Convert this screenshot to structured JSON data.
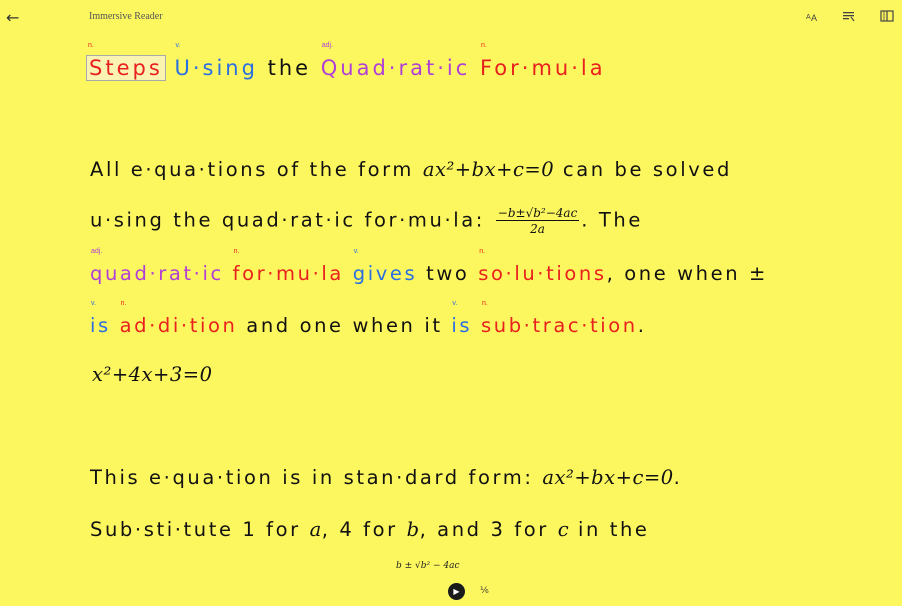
{
  "app": {
    "title": "Immersive Reader",
    "back_icon": "←",
    "icons": [
      "text-size-icon",
      "grammar-options-icon",
      "reading-preferences-icon"
    ]
  },
  "colors": {
    "background": "#fdf75f",
    "noun": "#e8201e",
    "verb": "#2a6fe0",
    "adjective": "#b13fd6"
  },
  "pos_labels": {
    "noun": "n.",
    "verb": "v.",
    "adjective": "adj."
  },
  "title": {
    "w1": "Steps",
    "w2": "U·sing",
    "w3": "the",
    "w4": "Quad·rat·ic",
    "w5": "For·mu·la"
  },
  "p1": {
    "t1": "All e·qua·tions of the form",
    "eq": "ax²+bx+c=0",
    "t2": "can be solved",
    "t3": "u·sing the quad·rat·ic for·mu·la:",
    "frac_num": "−b±√b²−4ac",
    "frac_den": "2a",
    "t4": ". The",
    "w_quad": "quad·rat·ic",
    "w_form": "for·mu·la",
    "w_gives": "gives",
    "t5": "two",
    "w_sol": "so·lu·tions",
    "t6": ", one when ±",
    "w_is1": "is",
    "w_add": "ad·di·tion",
    "t7": "and one when it",
    "w_is2": "is",
    "w_sub": "sub·trac·tion",
    "t8": "."
  },
  "eq2": "x²+4x+3=0",
  "p2": {
    "t1": "This e·qua·tion is in stan·dard form:",
    "eq": "ax²+bx+c=0",
    "t2": "."
  },
  "p3": {
    "t1": "Sub·sti·tute 1 for",
    "a": "a",
    "t2": ", 4 for",
    "b": "b",
    "t3": ", and 3 for",
    "c": "c",
    "t4": "in the"
  },
  "cut_formula": "b ± √b² − 4ac",
  "bottom": {
    "play_icon": "▶",
    "speed_label": "⅙"
  }
}
